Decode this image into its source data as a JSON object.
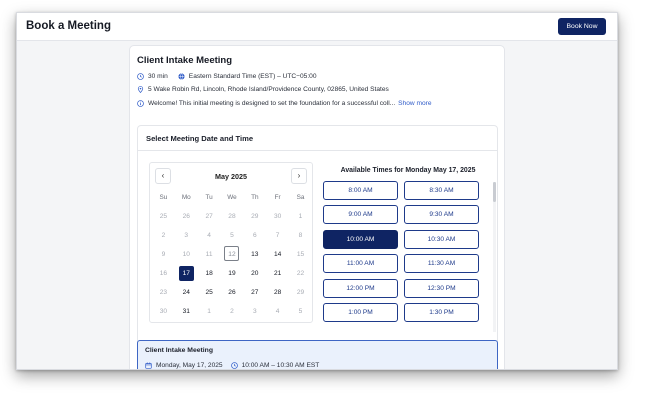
{
  "header": {
    "title": "Book a Meeting",
    "book_now_label": "Book Now"
  },
  "meeting": {
    "title": "Client Intake Meeting",
    "duration": "30 min",
    "timezone": "Eastern Standard Time (EST) – UTC−05:00",
    "location": "5 Wake Robin Rd, Lincoln, Rhode Island/Providence County, 02865, United States",
    "description": "Welcome! This initial meeting is designed to set the foundation for a successful coll...",
    "show_more_label": "Show more"
  },
  "picker": {
    "title": "Select Meeting Date and Time",
    "calendar": {
      "month_label": "May 2025",
      "prev_icon": "‹",
      "next_icon": "›",
      "weekdays": [
        "Su",
        "Mo",
        "Tu",
        "We",
        "Th",
        "Fr",
        "Sa"
      ],
      "weeks": [
        [
          {
            "n": "25",
            "s": "out"
          },
          {
            "n": "26",
            "s": "out"
          },
          {
            "n": "27",
            "s": "out"
          },
          {
            "n": "28",
            "s": "out"
          },
          {
            "n": "29",
            "s": "out"
          },
          {
            "n": "30",
            "s": "out"
          },
          {
            "n": "1",
            "s": "past"
          }
        ],
        [
          {
            "n": "2",
            "s": "past"
          },
          {
            "n": "3",
            "s": "past"
          },
          {
            "n": "4",
            "s": "past"
          },
          {
            "n": "5",
            "s": "past"
          },
          {
            "n": "6",
            "s": "past"
          },
          {
            "n": "7",
            "s": "past"
          },
          {
            "n": "8",
            "s": "past"
          }
        ],
        [
          {
            "n": "9",
            "s": "past"
          },
          {
            "n": "10",
            "s": "past"
          },
          {
            "n": "11",
            "s": "past"
          },
          {
            "n": "12",
            "s": "today"
          },
          {
            "n": "13",
            "s": "avail"
          },
          {
            "n": "14",
            "s": "avail"
          },
          {
            "n": "15",
            "s": "past"
          }
        ],
        [
          {
            "n": "16",
            "s": "past"
          },
          {
            "n": "17",
            "s": "selected"
          },
          {
            "n": "18",
            "s": "avail"
          },
          {
            "n": "19",
            "s": "avail"
          },
          {
            "n": "20",
            "s": "avail"
          },
          {
            "n": "21",
            "s": "avail"
          },
          {
            "n": "22",
            "s": "past"
          }
        ],
        [
          {
            "n": "23",
            "s": "past"
          },
          {
            "n": "24",
            "s": "avail"
          },
          {
            "n": "25",
            "s": "avail"
          },
          {
            "n": "26",
            "s": "avail"
          },
          {
            "n": "27",
            "s": "avail"
          },
          {
            "n": "28",
            "s": "avail"
          },
          {
            "n": "29",
            "s": "past"
          }
        ],
        [
          {
            "n": "30",
            "s": "past"
          },
          {
            "n": "31",
            "s": "avail"
          },
          {
            "n": "1",
            "s": "out"
          },
          {
            "n": "2",
            "s": "out"
          },
          {
            "n": "3",
            "s": "out"
          },
          {
            "n": "4",
            "s": "out"
          },
          {
            "n": "5",
            "s": "out"
          }
        ]
      ]
    },
    "times_title": "Available Times for Monday May 17, 2025",
    "slots": [
      {
        "label": "8:00 AM",
        "selected": false
      },
      {
        "label": "8:30 AM",
        "selected": false
      },
      {
        "label": "9:00 AM",
        "selected": false
      },
      {
        "label": "9:30 AM",
        "selected": false
      },
      {
        "label": "10:00 AM",
        "selected": true
      },
      {
        "label": "10:30 AM",
        "selected": false
      },
      {
        "label": "11:00 AM",
        "selected": false
      },
      {
        "label": "11:30 AM",
        "selected": false
      },
      {
        "label": "12:00 PM",
        "selected": false
      },
      {
        "label": "12:30 PM",
        "selected": false
      },
      {
        "label": "1:00 PM",
        "selected": false
      },
      {
        "label": "1:30 PM",
        "selected": false
      }
    ]
  },
  "summary": {
    "title": "Client Intake Meeting",
    "date": "Monday, May 17, 2025",
    "time": "10:00 AM – 10:30 AM EST"
  },
  "colors": {
    "primary": "#0f2463",
    "link": "#2f5bc8",
    "summary_bg": "#eaf1fc",
    "summary_border": "#3e66c4"
  },
  "icons": [
    "clock-icon",
    "globe-icon",
    "map-pin-icon",
    "info-icon",
    "calendar-icon",
    "chevron-left-icon",
    "chevron-right-icon"
  ]
}
